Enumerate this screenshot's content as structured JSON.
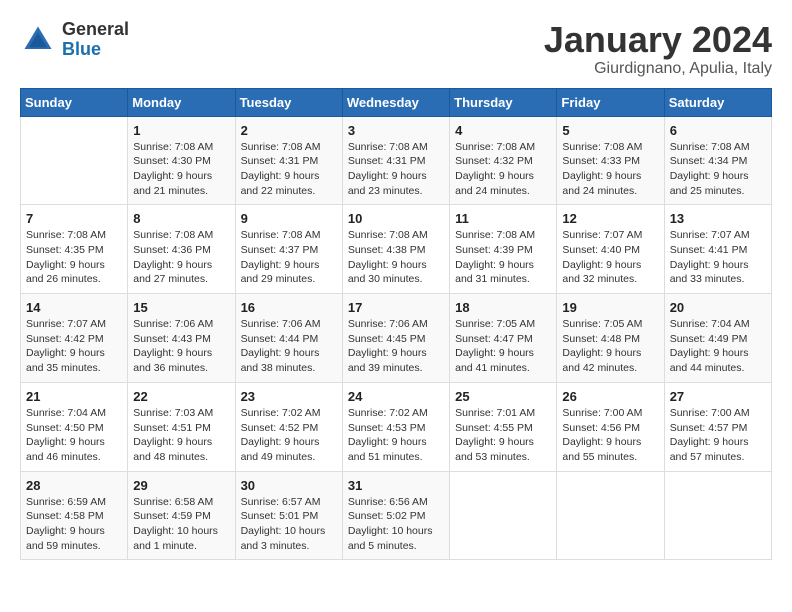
{
  "logo": {
    "general": "General",
    "blue": "Blue"
  },
  "header": {
    "title": "January 2024",
    "subtitle": "Giurdignano, Apulia, Italy"
  },
  "days_of_week": [
    "Sunday",
    "Monday",
    "Tuesday",
    "Wednesday",
    "Thursday",
    "Friday",
    "Saturday"
  ],
  "weeks": [
    [
      {
        "num": "",
        "detail": ""
      },
      {
        "num": "1",
        "detail": "Sunrise: 7:08 AM\nSunset: 4:30 PM\nDaylight: 9 hours\nand 21 minutes."
      },
      {
        "num": "2",
        "detail": "Sunrise: 7:08 AM\nSunset: 4:31 PM\nDaylight: 9 hours\nand 22 minutes."
      },
      {
        "num": "3",
        "detail": "Sunrise: 7:08 AM\nSunset: 4:31 PM\nDaylight: 9 hours\nand 23 minutes."
      },
      {
        "num": "4",
        "detail": "Sunrise: 7:08 AM\nSunset: 4:32 PM\nDaylight: 9 hours\nand 24 minutes."
      },
      {
        "num": "5",
        "detail": "Sunrise: 7:08 AM\nSunset: 4:33 PM\nDaylight: 9 hours\nand 24 minutes."
      },
      {
        "num": "6",
        "detail": "Sunrise: 7:08 AM\nSunset: 4:34 PM\nDaylight: 9 hours\nand 25 minutes."
      }
    ],
    [
      {
        "num": "7",
        "detail": "Sunrise: 7:08 AM\nSunset: 4:35 PM\nDaylight: 9 hours\nand 26 minutes."
      },
      {
        "num": "8",
        "detail": "Sunrise: 7:08 AM\nSunset: 4:36 PM\nDaylight: 9 hours\nand 27 minutes."
      },
      {
        "num": "9",
        "detail": "Sunrise: 7:08 AM\nSunset: 4:37 PM\nDaylight: 9 hours\nand 29 minutes."
      },
      {
        "num": "10",
        "detail": "Sunrise: 7:08 AM\nSunset: 4:38 PM\nDaylight: 9 hours\nand 30 minutes."
      },
      {
        "num": "11",
        "detail": "Sunrise: 7:08 AM\nSunset: 4:39 PM\nDaylight: 9 hours\nand 31 minutes."
      },
      {
        "num": "12",
        "detail": "Sunrise: 7:07 AM\nSunset: 4:40 PM\nDaylight: 9 hours\nand 32 minutes."
      },
      {
        "num": "13",
        "detail": "Sunrise: 7:07 AM\nSunset: 4:41 PM\nDaylight: 9 hours\nand 33 minutes."
      }
    ],
    [
      {
        "num": "14",
        "detail": "Sunrise: 7:07 AM\nSunset: 4:42 PM\nDaylight: 9 hours\nand 35 minutes."
      },
      {
        "num": "15",
        "detail": "Sunrise: 7:06 AM\nSunset: 4:43 PM\nDaylight: 9 hours\nand 36 minutes."
      },
      {
        "num": "16",
        "detail": "Sunrise: 7:06 AM\nSunset: 4:44 PM\nDaylight: 9 hours\nand 38 minutes."
      },
      {
        "num": "17",
        "detail": "Sunrise: 7:06 AM\nSunset: 4:45 PM\nDaylight: 9 hours\nand 39 minutes."
      },
      {
        "num": "18",
        "detail": "Sunrise: 7:05 AM\nSunset: 4:47 PM\nDaylight: 9 hours\nand 41 minutes."
      },
      {
        "num": "19",
        "detail": "Sunrise: 7:05 AM\nSunset: 4:48 PM\nDaylight: 9 hours\nand 42 minutes."
      },
      {
        "num": "20",
        "detail": "Sunrise: 7:04 AM\nSunset: 4:49 PM\nDaylight: 9 hours\nand 44 minutes."
      }
    ],
    [
      {
        "num": "21",
        "detail": "Sunrise: 7:04 AM\nSunset: 4:50 PM\nDaylight: 9 hours\nand 46 minutes."
      },
      {
        "num": "22",
        "detail": "Sunrise: 7:03 AM\nSunset: 4:51 PM\nDaylight: 9 hours\nand 48 minutes."
      },
      {
        "num": "23",
        "detail": "Sunrise: 7:02 AM\nSunset: 4:52 PM\nDaylight: 9 hours\nand 49 minutes."
      },
      {
        "num": "24",
        "detail": "Sunrise: 7:02 AM\nSunset: 4:53 PM\nDaylight: 9 hours\nand 51 minutes."
      },
      {
        "num": "25",
        "detail": "Sunrise: 7:01 AM\nSunset: 4:55 PM\nDaylight: 9 hours\nand 53 minutes."
      },
      {
        "num": "26",
        "detail": "Sunrise: 7:00 AM\nSunset: 4:56 PM\nDaylight: 9 hours\nand 55 minutes."
      },
      {
        "num": "27",
        "detail": "Sunrise: 7:00 AM\nSunset: 4:57 PM\nDaylight: 9 hours\nand 57 minutes."
      }
    ],
    [
      {
        "num": "28",
        "detail": "Sunrise: 6:59 AM\nSunset: 4:58 PM\nDaylight: 9 hours\nand 59 minutes."
      },
      {
        "num": "29",
        "detail": "Sunrise: 6:58 AM\nSunset: 4:59 PM\nDaylight: 10 hours\nand 1 minute."
      },
      {
        "num": "30",
        "detail": "Sunrise: 6:57 AM\nSunset: 5:01 PM\nDaylight: 10 hours\nand 3 minutes."
      },
      {
        "num": "31",
        "detail": "Sunrise: 6:56 AM\nSunset: 5:02 PM\nDaylight: 10 hours\nand 5 minutes."
      },
      {
        "num": "",
        "detail": ""
      },
      {
        "num": "",
        "detail": ""
      },
      {
        "num": "",
        "detail": ""
      }
    ]
  ]
}
